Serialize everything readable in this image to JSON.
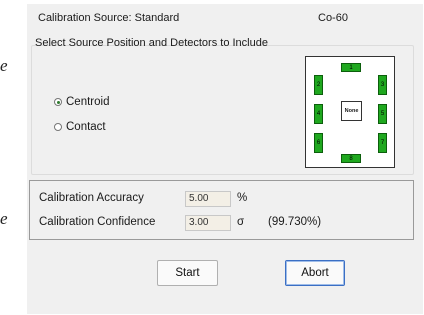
{
  "side_glyphs": [
    "e",
    "e"
  ],
  "header": {
    "source_text": "Calibration Source:  Standard",
    "isotope": "Co-60"
  },
  "position_group": {
    "title": "Select Source Position and Detectors to Include",
    "options": [
      {
        "label": "Centroid",
        "selected": true
      },
      {
        "label": "Contact",
        "selected": false
      }
    ]
  },
  "detectors": {
    "items": [
      "1",
      "2",
      "3",
      "4",
      "5",
      "6",
      "7",
      "8"
    ],
    "center_label": "None",
    "active_color": "#1fa81f"
  },
  "accuracy": {
    "accuracy_label": "Calibration Accuracy",
    "accuracy_value": "5.00",
    "accuracy_unit": "%",
    "confidence_label": "Calibration Confidence",
    "confidence_value": "3.00",
    "confidence_unit": "σ",
    "confidence_percent": "(99.730%)"
  },
  "buttons": {
    "start": "Start",
    "abort": "Abort"
  }
}
